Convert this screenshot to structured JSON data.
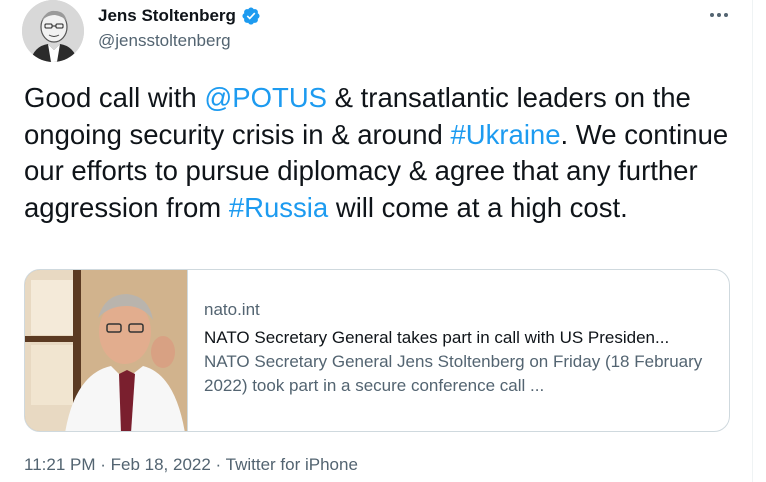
{
  "author": {
    "name": "Jens Stoltenberg",
    "handle": "@jensstoltenberg",
    "verified": true
  },
  "colors": {
    "accent": "#1d9bf0",
    "text_primary": "#0f1419",
    "text_secondary": "#536471",
    "border": "#cfd9de"
  },
  "icons": {
    "more": "more-horizontal-icon",
    "verified": "verified-badge-icon"
  },
  "tweet": {
    "p1": "Good call with ",
    "mention": "@POTUS",
    "p2": " & transatlantic leaders on the ongoing security crisis in & around ",
    "hashtag1": "#Ukraine",
    "p3": ". We continue our efforts to pursue diplomacy & agree that any further aggression from ",
    "hashtag2": "#Russia",
    "p4": " will come at a high cost."
  },
  "card": {
    "domain": "nato.int",
    "title": "NATO Secretary General takes part in call with US Presiden...",
    "description": "NATO Secretary General Jens Stoltenberg on Friday (18 February 2022) took part in a secure conference call ..."
  },
  "meta": {
    "time": "11:21 PM",
    "sep1": " · ",
    "date": "Feb 18, 2022",
    "sep2": " · ",
    "source": "Twitter for iPhone"
  }
}
